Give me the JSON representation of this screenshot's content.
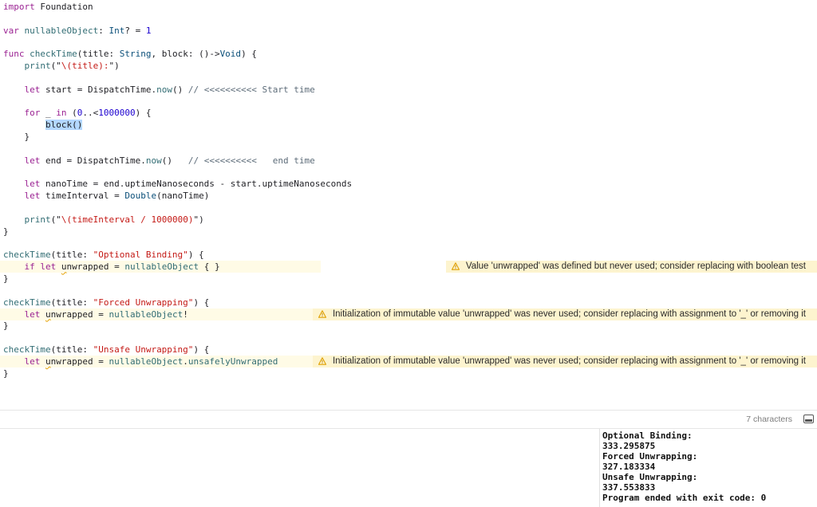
{
  "editor": {
    "lines": [
      {
        "tokens": [
          {
            "t": "import",
            "c": "kw"
          },
          {
            "t": " Foundation"
          }
        ]
      },
      {
        "tokens": []
      },
      {
        "tokens": [
          {
            "t": "var",
            "c": "kw"
          },
          {
            "t": " "
          },
          {
            "t": "nullableObject",
            "c": "fn"
          },
          {
            "t": ": "
          },
          {
            "t": "Int",
            "c": "ty"
          },
          {
            "t": "? = "
          },
          {
            "t": "1",
            "c": "numc"
          }
        ]
      },
      {
        "tokens": []
      },
      {
        "tokens": [
          {
            "t": "func",
            "c": "kw"
          },
          {
            "t": " "
          },
          {
            "t": "checkTime",
            "c": "fn"
          },
          {
            "t": "(title: "
          },
          {
            "t": "String",
            "c": "ty"
          },
          {
            "t": ", block: ()->"
          },
          {
            "t": "Void",
            "c": "ty"
          },
          {
            "t": ") {"
          }
        ]
      },
      {
        "tokens": [
          {
            "t": "    "
          },
          {
            "t": "print",
            "c": "prop"
          },
          {
            "t": "(\""
          },
          {
            "t": "\\(title):",
            "c": "strc"
          },
          {
            "t": "\")"
          }
        ]
      },
      {
        "tokens": []
      },
      {
        "tokens": [
          {
            "t": "    "
          },
          {
            "t": "let",
            "c": "kw"
          },
          {
            "t": " start = DispatchTime."
          },
          {
            "t": "now",
            "c": "prop"
          },
          {
            "t": "() "
          },
          {
            "t": "// <<<<<<<<<< Start time",
            "c": "cmt"
          }
        ]
      },
      {
        "tokens": []
      },
      {
        "tokens": [
          {
            "t": "    "
          },
          {
            "t": "for",
            "c": "kw"
          },
          {
            "t": " _ "
          },
          {
            "t": "in",
            "c": "kw"
          },
          {
            "t": " ("
          },
          {
            "t": "0",
            "c": "numc"
          },
          {
            "t": "..<"
          },
          {
            "t": "1000000",
            "c": "numc"
          },
          {
            "t": ") {"
          }
        ]
      },
      {
        "tokens": [
          {
            "t": "        "
          },
          {
            "t": "block()",
            "c": "sel"
          }
        ]
      },
      {
        "tokens": [
          {
            "t": "    }"
          }
        ]
      },
      {
        "tokens": []
      },
      {
        "tokens": [
          {
            "t": "    "
          },
          {
            "t": "let",
            "c": "kw"
          },
          {
            "t": " end = DispatchTime."
          },
          {
            "t": "now",
            "c": "prop"
          },
          {
            "t": "()   "
          },
          {
            "t": "// <<<<<<<<<<   end time",
            "c": "cmt"
          }
        ]
      },
      {
        "tokens": []
      },
      {
        "tokens": [
          {
            "t": "    "
          },
          {
            "t": "let",
            "c": "kw"
          },
          {
            "t": " nanoTime = end.uptimeNanoseconds - start.uptimeNanoseconds"
          }
        ]
      },
      {
        "tokens": [
          {
            "t": "    "
          },
          {
            "t": "let",
            "c": "kw"
          },
          {
            "t": " timeInterval = "
          },
          {
            "t": "Double",
            "c": "ty"
          },
          {
            "t": "(nanoTime)"
          }
        ]
      },
      {
        "tokens": []
      },
      {
        "tokens": [
          {
            "t": "    "
          },
          {
            "t": "print",
            "c": "prop"
          },
          {
            "t": "(\""
          },
          {
            "t": "\\(timeInterval / 1000000)",
            "c": "strc"
          },
          {
            "t": "\")"
          }
        ]
      },
      {
        "tokens": [
          {
            "t": "}"
          }
        ]
      },
      {
        "tokens": []
      },
      {
        "tokens": [
          {
            "t": "checkTime",
            "c": "fn"
          },
          {
            "t": "(title: "
          },
          {
            "t": "\"Optional Binding\"",
            "c": "strc"
          },
          {
            "t": ") {"
          }
        ]
      },
      {
        "tokens": [
          {
            "t": "    "
          },
          {
            "t": "if",
            "c": "kw"
          },
          {
            "t": " "
          },
          {
            "t": "let",
            "c": "kw"
          },
          {
            "t": " "
          },
          {
            "t": "u",
            "c": "squig"
          },
          {
            "t": "nwrapped = "
          },
          {
            "t": "nullableObject",
            "c": "fn"
          },
          {
            "t": " { }"
          }
        ],
        "warning": "Value 'unwrapped' was defined but never used; consider replacing with boolean test"
      },
      {
        "tokens": [
          {
            "t": "}"
          }
        ]
      },
      {
        "tokens": []
      },
      {
        "tokens": [
          {
            "t": "checkTime",
            "c": "fn"
          },
          {
            "t": "(title: "
          },
          {
            "t": "\"Forced Unwrapping\"",
            "c": "strc"
          },
          {
            "t": ") {"
          }
        ]
      },
      {
        "tokens": [
          {
            "t": "    "
          },
          {
            "t": "let",
            "c": "kw"
          },
          {
            "t": " "
          },
          {
            "t": "u",
            "c": "squig"
          },
          {
            "t": "nwrapped = "
          },
          {
            "t": "nullableObject",
            "c": "fn"
          },
          {
            "t": "!"
          }
        ],
        "warning": "Initialization of immutable value 'unwrapped' was never used; consider replacing with assignment to '_' or removing it"
      },
      {
        "tokens": [
          {
            "t": "}"
          }
        ]
      },
      {
        "tokens": []
      },
      {
        "tokens": [
          {
            "t": "checkTime",
            "c": "fn"
          },
          {
            "t": "(title: "
          },
          {
            "t": "\"Unsafe Unwrapping\"",
            "c": "strc"
          },
          {
            "t": ") {"
          }
        ]
      },
      {
        "tokens": [
          {
            "t": "    "
          },
          {
            "t": "let",
            "c": "kw"
          },
          {
            "t": " "
          },
          {
            "t": "u",
            "c": "squig"
          },
          {
            "t": "nwrapped = "
          },
          {
            "t": "nullableObject",
            "c": "fn"
          },
          {
            "t": "."
          },
          {
            "t": "unsafelyUnwrapped",
            "c": "prop"
          }
        ],
        "warning": "Initialization of immutable value 'unwrapped' was never used; consider replacing with assignment to '_' or removing it"
      },
      {
        "tokens": [
          {
            "t": "}"
          }
        ]
      }
    ]
  },
  "statusbar": {
    "char_count": "7 characters"
  },
  "console": {
    "output": "Optional Binding:\n333.295875\nForced Unwrapping:\n327.183334\nUnsafe Unwrapping:\n337.553833\nProgram ended with exit code: 0"
  },
  "colors": {
    "keyword": "#9b2393",
    "type": "#0b4f79",
    "function": "#326d74",
    "string": "#c41a16",
    "number": "#1c00cf",
    "comment": "#5d6c79",
    "warning_bg": "#fdf4cf",
    "selection": "#b3d7ff"
  }
}
